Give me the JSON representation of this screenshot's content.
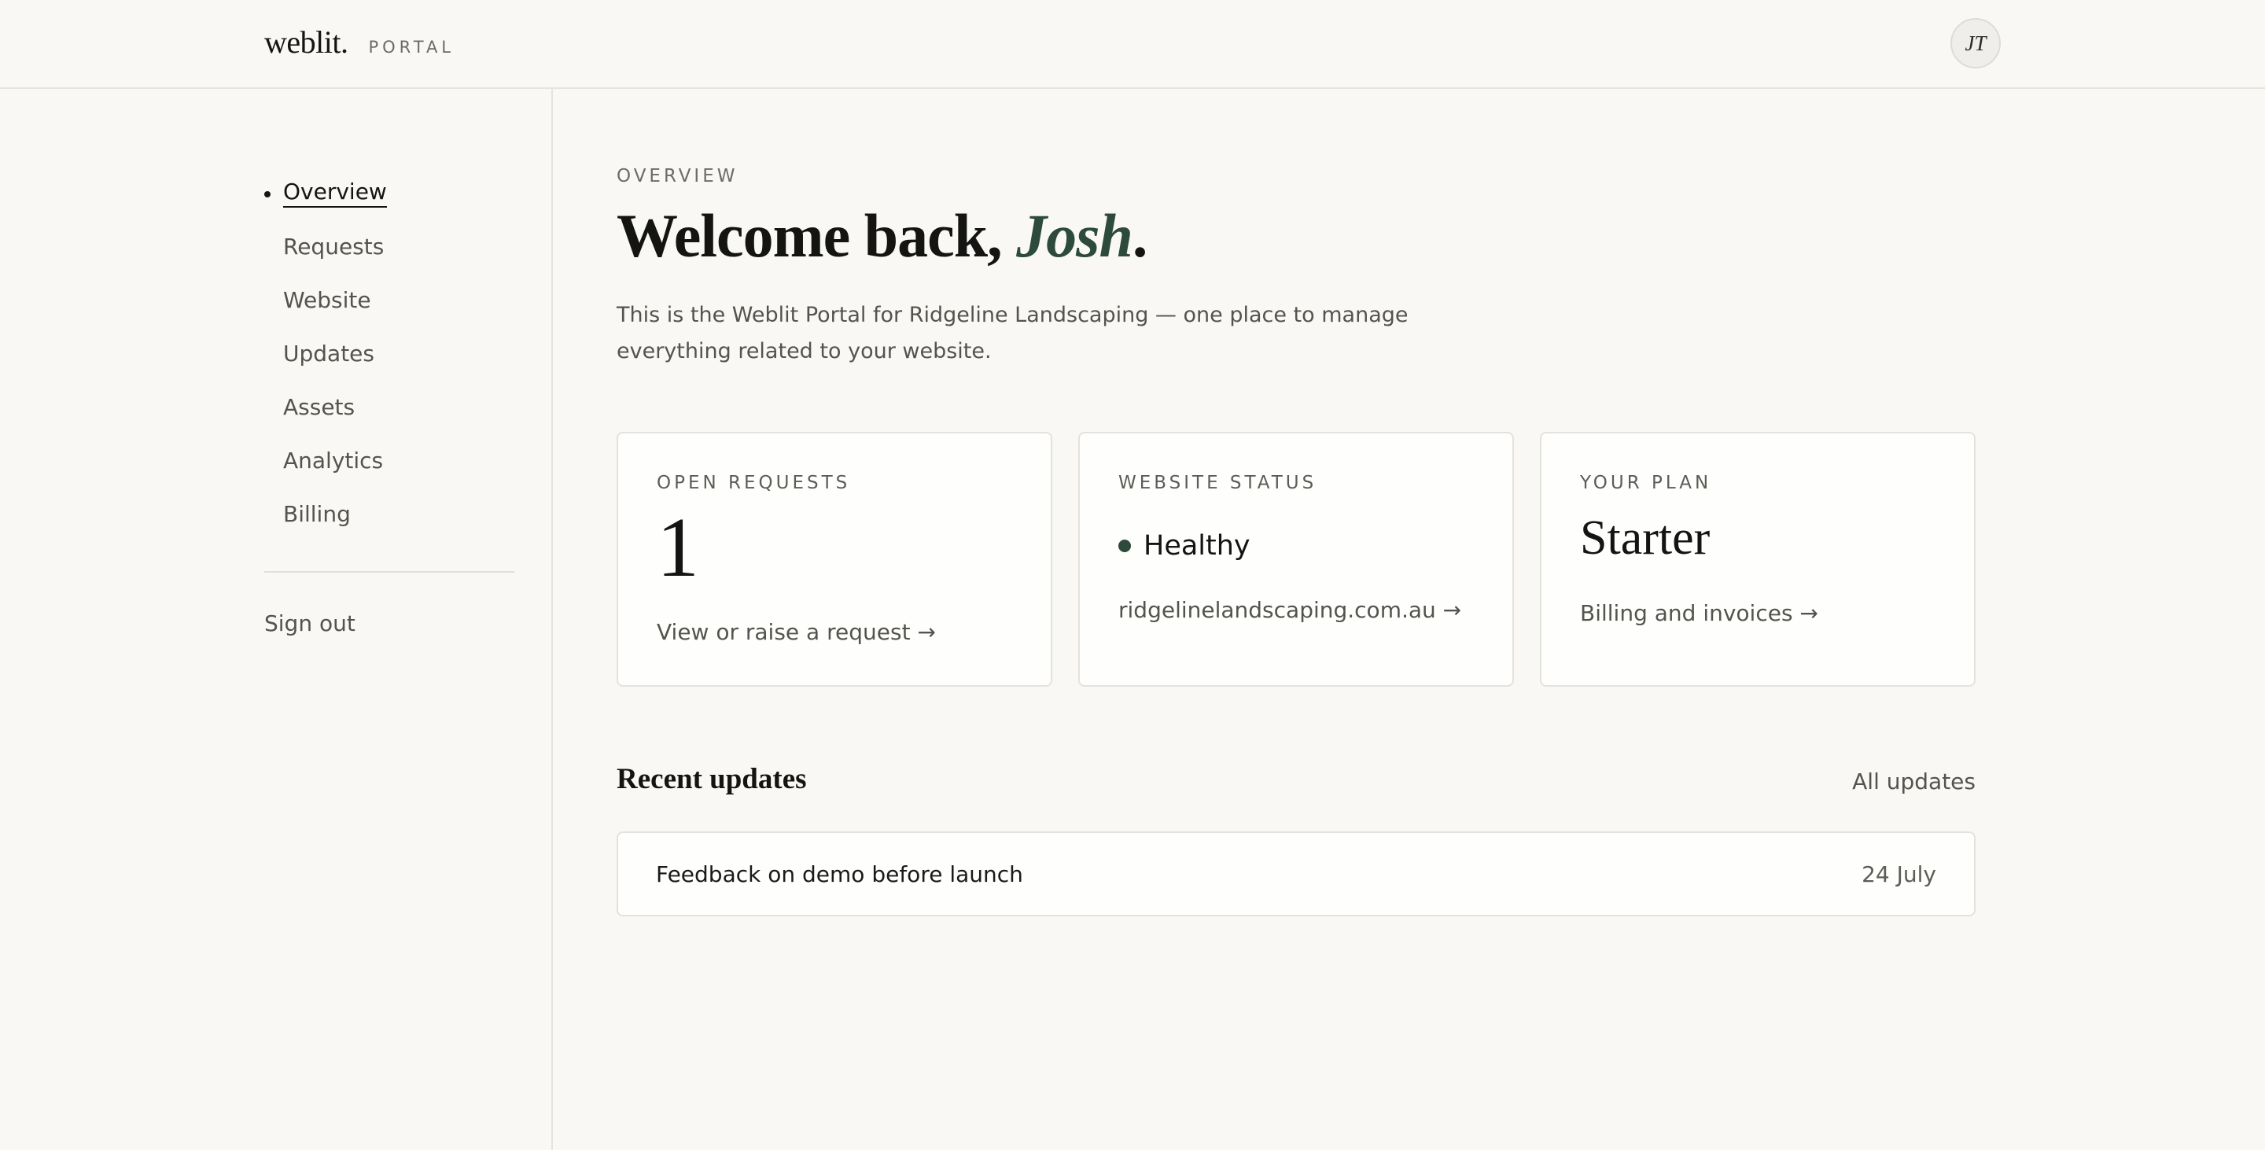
{
  "header": {
    "logo": "weblit.",
    "portal_label": "PORTAL",
    "avatar_initials": "JT"
  },
  "sidebar": {
    "items": [
      {
        "label": "Overview",
        "active": true
      },
      {
        "label": "Requests",
        "active": false
      },
      {
        "label": "Website",
        "active": false
      },
      {
        "label": "Updates",
        "active": false
      },
      {
        "label": "Assets",
        "active": false
      },
      {
        "label": "Analytics",
        "active": false
      },
      {
        "label": "Billing",
        "active": false
      }
    ],
    "sign_out": "Sign out"
  },
  "main": {
    "eyebrow": "OVERVIEW",
    "welcome_prefix": "Welcome back, ",
    "user_name": "Josh",
    "welcome_suffix": ".",
    "intro": "This is the Weblit Portal for Ridgeline Landscaping — one place to manage everything related to your website.",
    "cards": {
      "requests": {
        "label": "OPEN REQUESTS",
        "count": "1",
        "link": "View or raise a request →"
      },
      "website": {
        "label": "WEBSITE STATUS",
        "status": "Healthy",
        "link": "ridgelinelandscaping.com.au →"
      },
      "plan": {
        "label": "YOUR PLAN",
        "plan_name": "Starter",
        "link": "Billing and invoices →"
      }
    },
    "recent_updates": {
      "title": "Recent updates",
      "all_link": "All updates",
      "items": [
        {
          "title": "Feedback on demo before launch",
          "date": "24 July"
        }
      ]
    }
  },
  "colors": {
    "background": "#f9f8f5",
    "accent_green": "#2e4a3c",
    "text_primary": "#141412",
    "text_muted": "#55534e",
    "border": "#e4e2dc"
  }
}
